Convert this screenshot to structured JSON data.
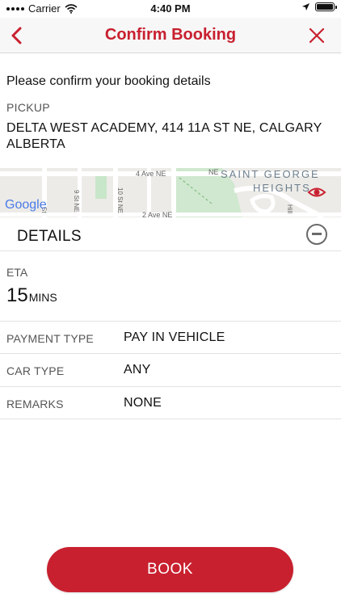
{
  "status_bar": {
    "carrier": "Carrier",
    "time": "4:40 PM",
    "battery_level": 1.0
  },
  "nav": {
    "title": "Confirm Booking",
    "back_icon": "chevron-left-icon",
    "close_icon": "close-icon"
  },
  "confirm_text": "Please confirm your booking details",
  "pickup": {
    "label": "PICKUP",
    "address": "DELTA WEST ACADEMY, 414 11A ST NE, CALGARY ALBERTA"
  },
  "map": {
    "brand": "Google",
    "labels": {
      "street_4ave": "4 Ave NE",
      "street_2ave": "2 Ave NE",
      "street_9st": "9 St NE",
      "street_10st": "10 St NE",
      "street_other": "St",
      "neighbourhood_line1": "SAINT GEORGE",
      "neighbourhood_line2": "HEIGHTS",
      "edge_left": "NE",
      "edge_right": "Hill"
    }
  },
  "details": {
    "title": "DETAILS",
    "eta_label": "ETA",
    "eta_value": "15",
    "eta_unit": "MINS",
    "rows": [
      {
        "label": "PAYMENT TYPE",
        "value": "PAY IN VEHICLE"
      },
      {
        "label": "CAR TYPE",
        "value": "ANY"
      },
      {
        "label": "REMARKS",
        "value": "NONE"
      }
    ]
  },
  "book_button": "BOOK",
  "colors": {
    "brand_red": "#c8202f",
    "nav_bg": "#f7f7f7",
    "map_park": "#c8e6c9"
  }
}
